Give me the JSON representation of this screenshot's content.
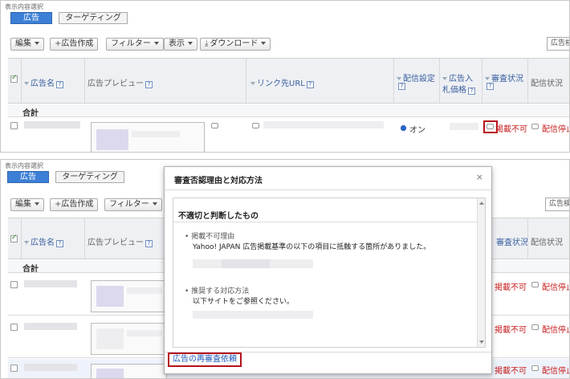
{
  "display_selection_label": "表示内容選択",
  "tabs": {
    "ads": "広告",
    "targeting": "ターゲティング"
  },
  "toolbar": {
    "edit": "編集",
    "create": "広告作成",
    "create_plus": "+",
    "filter": "フィルター",
    "display": "表示",
    "download": "ダウンロード",
    "download_icon": "⤓",
    "search_placeholder": "広告検"
  },
  "columns": {
    "ad_name": "広告名",
    "preview": "広告プレビュー",
    "link_url": "リンク先URL",
    "delivery_setting": "配信設定",
    "bid_price_line1": "広告入",
    "bid_price_line2": "札価格",
    "review_status": "審査状況",
    "delivery_status": "配信状況",
    "help_mark": "?"
  },
  "total_label": "合計",
  "row": {
    "delivery_on": "オン",
    "review_rejected": "掲載不可",
    "delivery_stopped": "配信停止"
  },
  "modal": {
    "title": "審査否認理由と対応方法",
    "close": "×",
    "section_title": "不適切と判断したもの",
    "reason_label": "掲載不可理由",
    "reason_text": "Yahoo! JAPAN 広告掲載基準の以下の項目に抵触する箇所がありました。",
    "action_label": "推奨する対応方法",
    "action_text": "以下サイトをご参照ください。",
    "bullet": "•",
    "reexam_link": "広告の再審査依頼"
  },
  "colors": {
    "accent_blue": "#3c7fd6",
    "link_blue": "#1f5ab8",
    "error_red": "#c51b1b",
    "highlight_red": "#b5121b"
  }
}
